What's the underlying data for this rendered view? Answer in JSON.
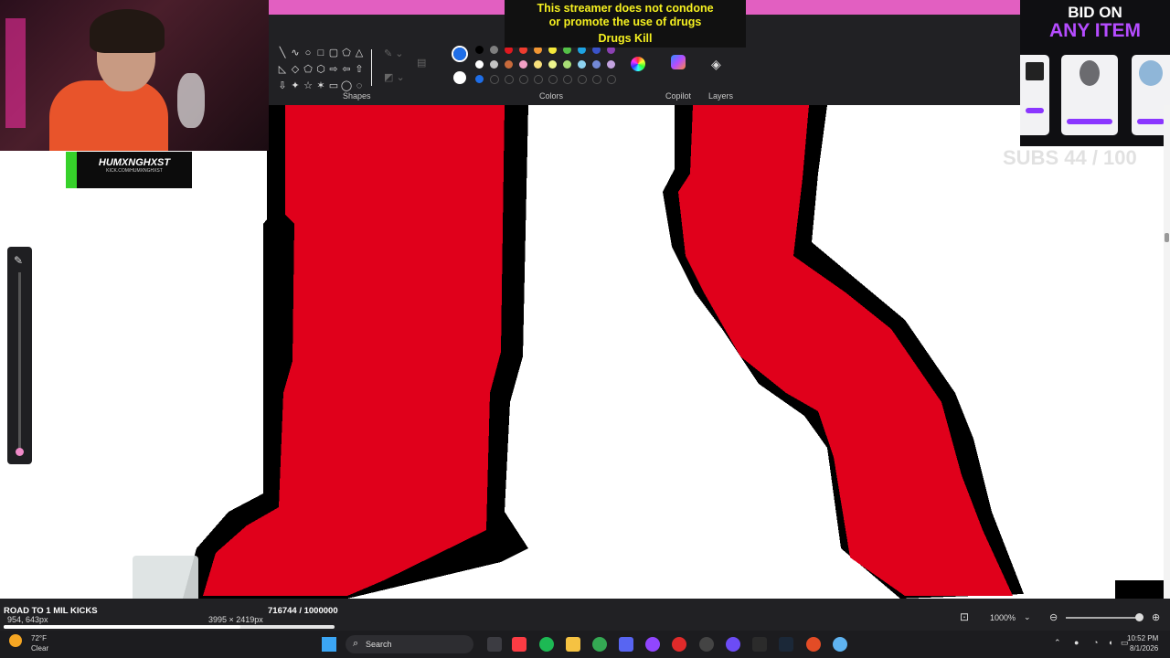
{
  "overlay": {
    "disclaimer_line1": "This streamer does not condone",
    "disclaimer_line2": "or promote the use of drugs",
    "disclaimer_line3": "Drugs Kill",
    "streamer_name": "HUMXNGHXST",
    "streamer_url": "KICK.COM/HUMXNGHXST",
    "bid_line1": "BID ON",
    "bid_line2": "ANY ITEM",
    "subs_goal": "SUBS 44 / 100",
    "road_label": "ROAD TO 1 MIL KICKS",
    "kicks_counter": "716744 / 1000000"
  },
  "toolbar": {
    "shapes_label": "Shapes",
    "colors_label": "Colors",
    "copilot_label": "Copilot",
    "layers_label": "Layers",
    "palette_row1": [
      "#000000",
      "#7f7f7f",
      "#e0181f",
      "#ee3c2f",
      "#f29633",
      "#f5e83a",
      "#55c148",
      "#1ea3e2",
      "#3a53c9",
      "#8b41b3"
    ],
    "palette_row2": [
      "#ffffff",
      "#c3c3c3",
      "#c86a3b",
      "#f3a0c6",
      "#f8e07c",
      "#eef58d",
      "#a9dd76",
      "#8dd2f0",
      "#7389d6",
      "#c3a3e0"
    ],
    "palette_row3": [
      "#1e6ee8"
    ],
    "selected_color": "#1e6ee8",
    "secondary_color": "#ffffff"
  },
  "status": {
    "cursor_position": "954, 643px",
    "image_size": "3995 × 2419px",
    "zoom_level": "1000%"
  },
  "taskbar": {
    "weather_temp": "72°F",
    "weather_desc": "Clear",
    "search_placeholder": "Search",
    "time": "10:52 PM",
    "date": "8/1/2026"
  },
  "colors": {
    "paint_red": "#e0001b",
    "outline": "#000000",
    "accent_pink": "#e25fc1",
    "kick_green": "#36d12a"
  }
}
